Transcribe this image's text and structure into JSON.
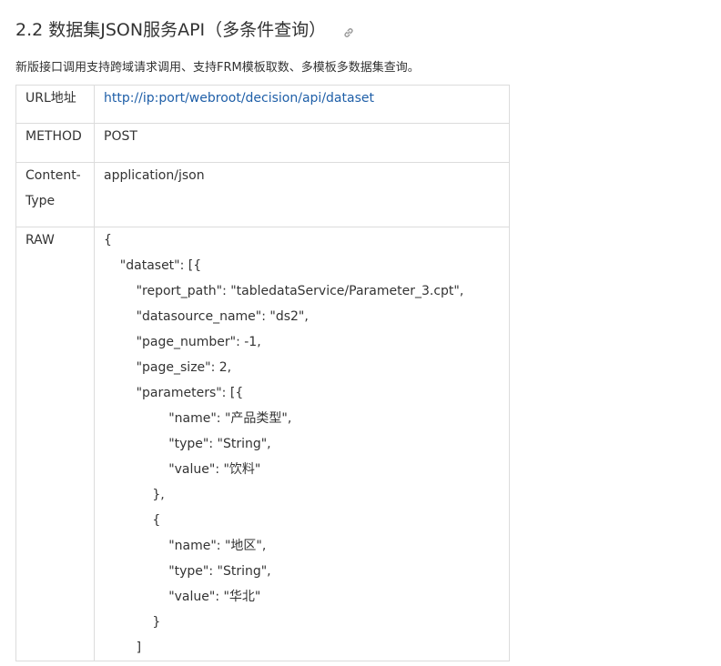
{
  "heading": {
    "title": "2.2 数据集JSON服务API（多条件查询）",
    "anchor_icon": "link-icon"
  },
  "intro": "新版接口调用支持跨域请求调用、支持FRM模板取数、多模板多数据集查询。",
  "table": {
    "url": {
      "label": "URL地址",
      "value": "http://ip:port/webroot/decision/api/dataset"
    },
    "method": {
      "label": "METHOD",
      "value": "POST"
    },
    "content_type": {
      "label": "Content-Type",
      "value": "application/json"
    },
    "raw": {
      "label": "RAW",
      "lines": [
        "{",
        "    \"dataset\": [{",
        "        \"report_path\": \"tabledataService/Parameter_3.cpt\",",
        "        \"datasource_name\": \"ds2\",",
        "        \"page_number\": -1,",
        "        \"page_size\": 2,",
        "        \"parameters\": [{",
        "                \"name\": \"产品类型\",",
        "                \"type\": \"String\",",
        "                \"value\": \"饮料\"",
        "            },",
        "            {",
        "                \"name\": \"地区\",",
        "                \"type\": \"String\",",
        "                \"value\": \"华北\"",
        "            }",
        "        ]"
      ]
    }
  },
  "colors": {
    "text": "#333333",
    "link": "#1f5fa8",
    "border": "#dcdcdc"
  }
}
